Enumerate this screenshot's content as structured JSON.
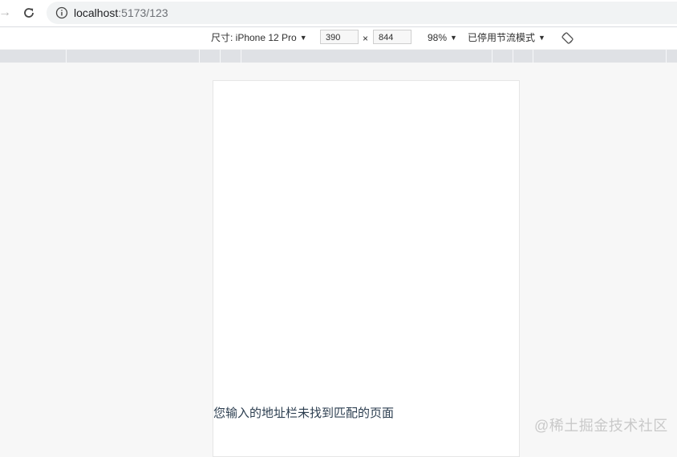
{
  "browser": {
    "url_host": "localhost",
    "url_path": ":5173/123"
  },
  "device_toolbar": {
    "dimensions_label": "尺寸: iPhone 12 Pro",
    "width_value": "390",
    "times_sign": "×",
    "height_value": "844",
    "zoom": "98%",
    "throttling": "已停用节流模式"
  },
  "page": {
    "not_found_message": "您输入的地址栏未找到匹配的页面"
  },
  "watermark": "@稀土掘金技术社区"
}
